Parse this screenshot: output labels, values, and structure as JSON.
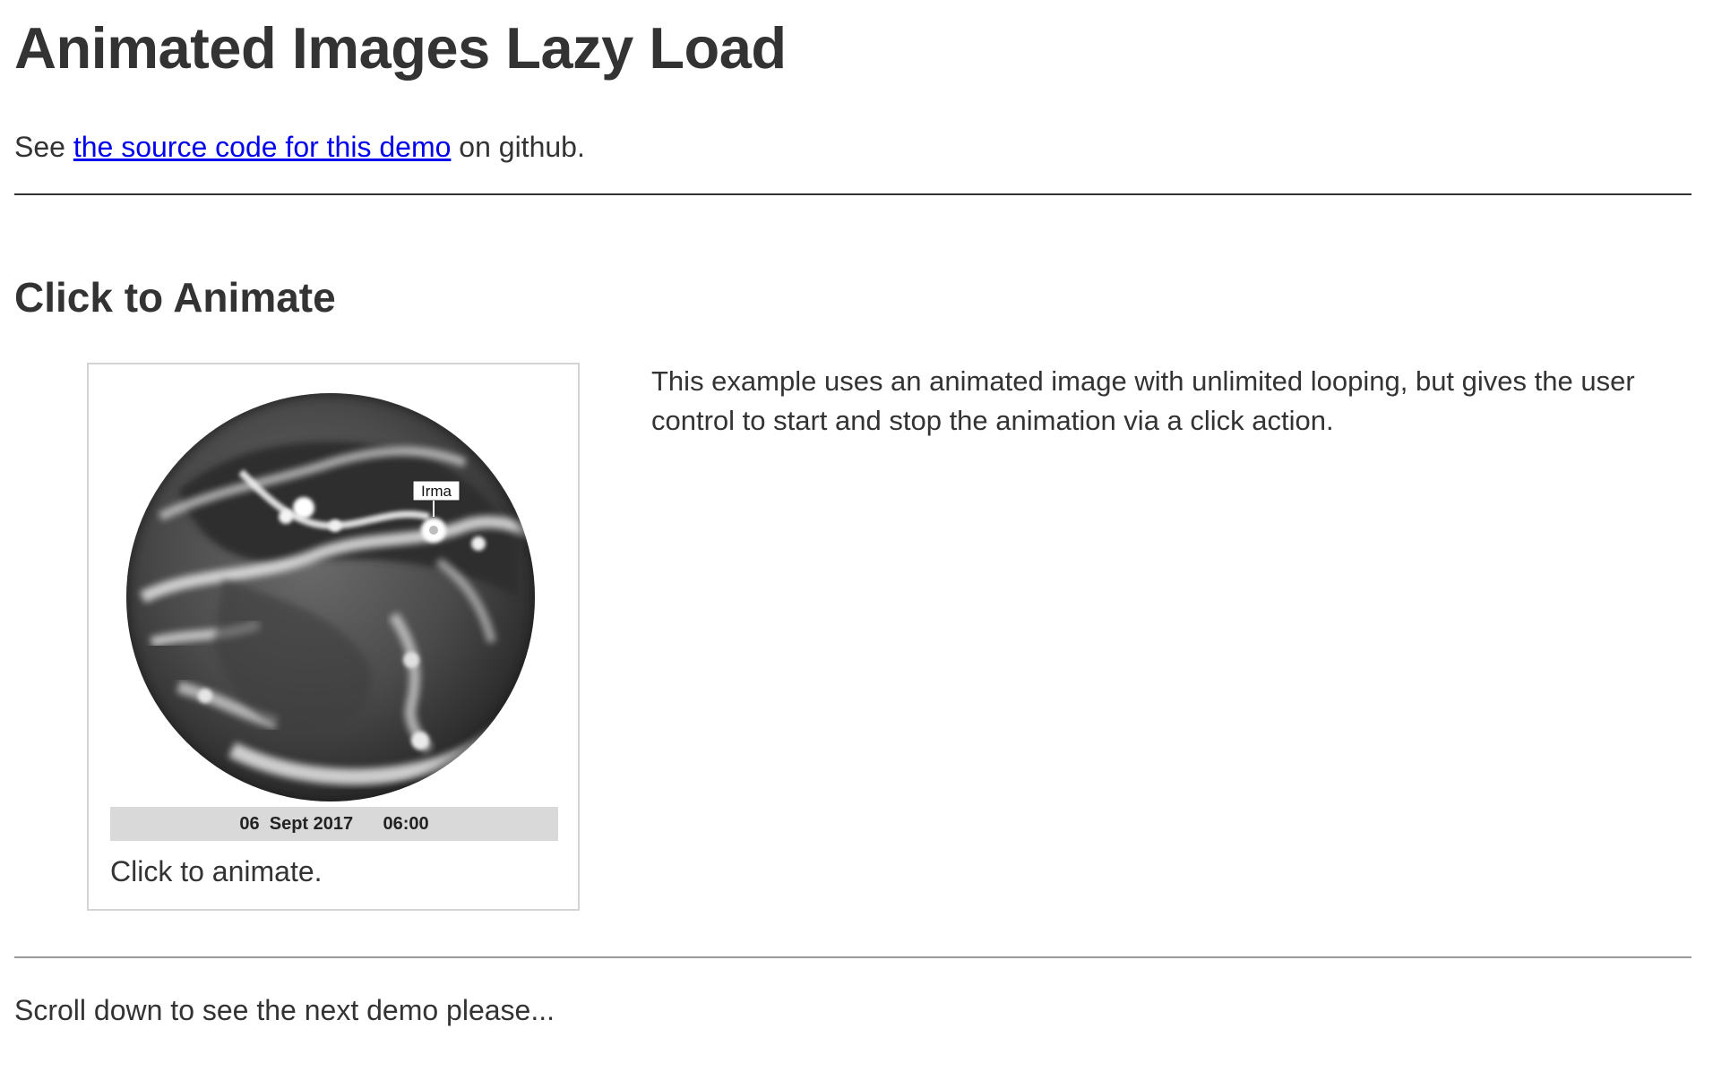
{
  "page": {
    "title": "Animated Images Lazy Load"
  },
  "intro": {
    "prefix": "See ",
    "link_text": "the source code for this demo",
    "suffix": " on github."
  },
  "section": {
    "title": "Click to Animate"
  },
  "figure": {
    "image_label": "Irma",
    "timestamp": "06  Sept 2017      06:00",
    "caption": "Click to animate."
  },
  "description": {
    "text": "This example uses an animated image with unlimited looping, but gives the user control to start and stop the animation via a click action."
  },
  "footer": {
    "note": "Scroll down to see the next demo please..."
  },
  "colors": {
    "text": "#333333",
    "link": "#0000ee",
    "figure_border": "#d4d4d4",
    "timestamp_bg": "#d9d9d9"
  }
}
